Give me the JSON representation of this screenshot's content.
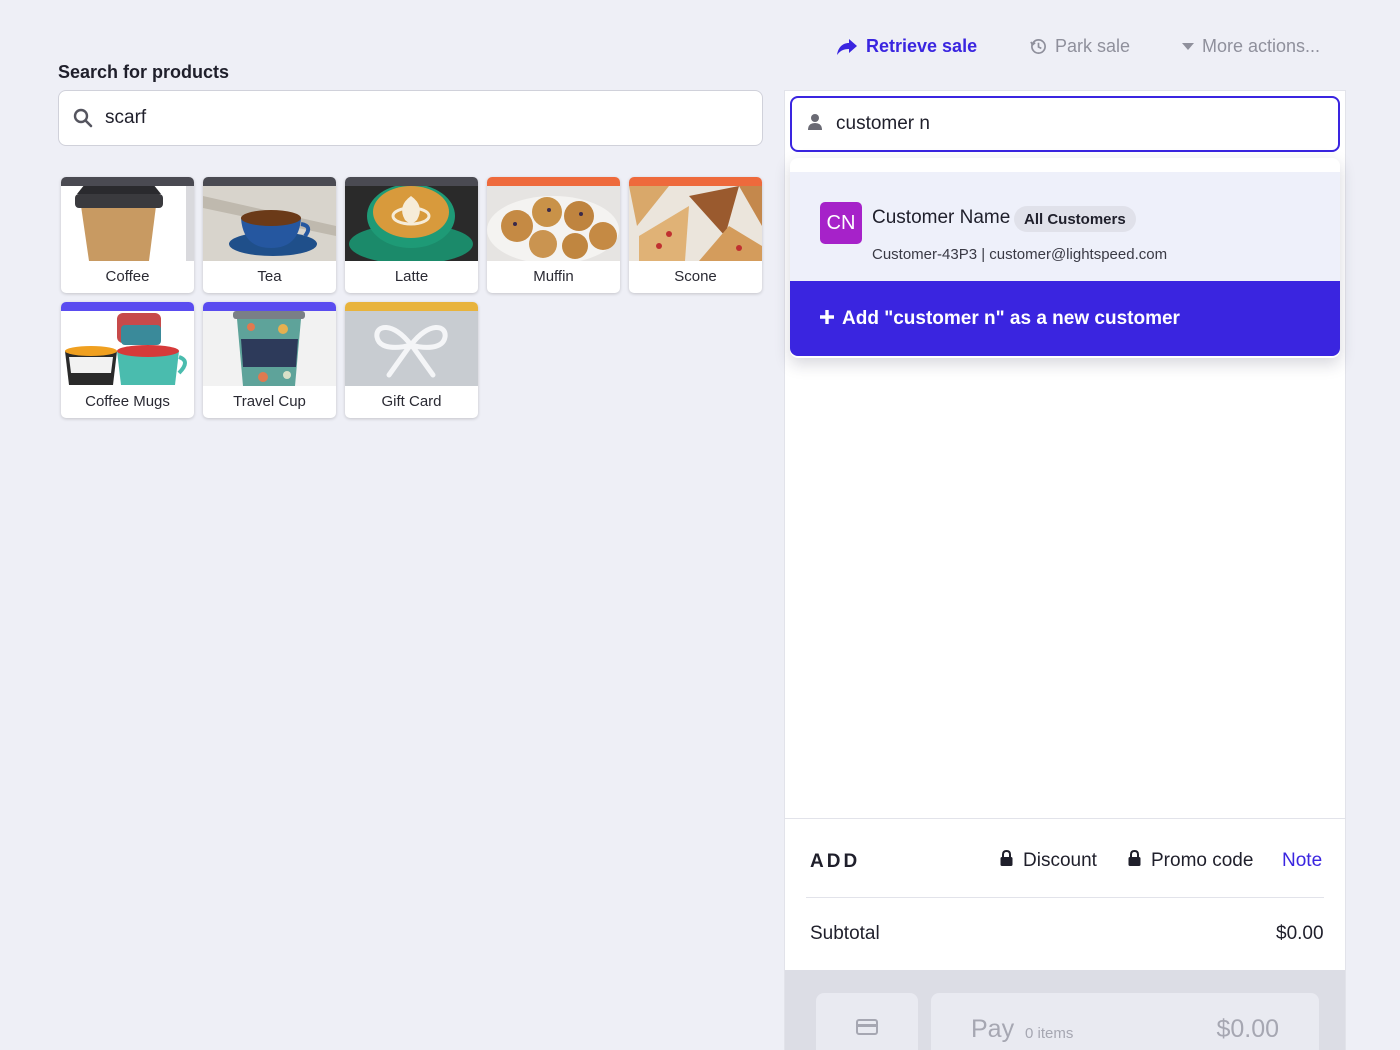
{
  "top_actions": {
    "retrieve_label": "Retrieve sale",
    "park_label": "Park sale",
    "more_label": "More actions..."
  },
  "search": {
    "label": "Search for products",
    "value": "scarf"
  },
  "products": [
    {
      "name": "Coffee",
      "bar_color": "#4a4a52"
    },
    {
      "name": "Tea",
      "bar_color": "#4a4a52"
    },
    {
      "name": "Latte",
      "bar_color": "#4a4a52"
    },
    {
      "name": "Muffin",
      "bar_color": "#ee6a3c"
    },
    {
      "name": "Scone",
      "bar_color": "#ee6a3c"
    },
    {
      "name": "Coffee Mugs",
      "bar_color": "#5a4cf0"
    },
    {
      "name": "Travel Cup",
      "bar_color": "#5a4cf0"
    },
    {
      "name": "Gift Card",
      "bar_color": "#e8b33c"
    }
  ],
  "customer_search": {
    "value": "customer n"
  },
  "customer_result": {
    "initials": "CN",
    "name": "Customer Name",
    "group": "All Customers",
    "detail": "Customer-43P3 | customer@lightspeed.com"
  },
  "add_customer_label": "Add \"customer n\" as a new customer",
  "footer": {
    "add_label": "ADD",
    "discount_label": "Discount",
    "promo_label": "Promo code",
    "note_label": "Note",
    "subtotal_label": "Subtotal",
    "subtotal_value": "$0.00"
  },
  "pay": {
    "label": "Pay",
    "items": "0 items",
    "total": "$0.00"
  },
  "colors": {
    "accent": "#3a25e0",
    "avatar": "#a622c9"
  }
}
